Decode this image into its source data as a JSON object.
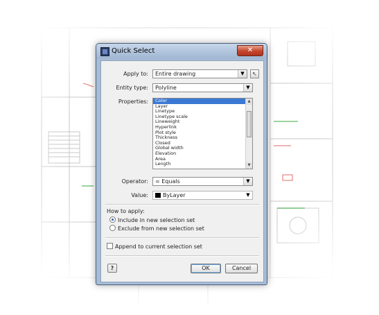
{
  "dialog": {
    "title": "Quick Select",
    "close_glyph": "✕",
    "apply_to": {
      "label": "Apply to:",
      "value": "Entire drawing"
    },
    "pick_icon": "select-objects-icon",
    "entity_type": {
      "label": "Entity type:",
      "value": "Polyline"
    },
    "properties": {
      "label": "Properties:",
      "items": [
        "Color",
        "Layer",
        "Linetype",
        "Linetype scale",
        "Lineweight",
        "Hyperlink",
        "Plot style",
        "Thickness",
        "Closed",
        "Global width",
        "Elevation",
        "Area",
        "Length"
      ],
      "selected_index": 0
    },
    "operator": {
      "label": "Operator:",
      "value": "= Equals"
    },
    "value_field": {
      "label": "Value:",
      "value": "ByLayer",
      "swatch_color": "#000000"
    },
    "how_to_apply": {
      "label": "How to apply:",
      "include": "Include in new selection set",
      "exclude": "Exclude from new selection set",
      "selected": "include"
    },
    "append_label": "Append to current selection set",
    "append_checked": false,
    "help_label": "?",
    "ok_label": "OK",
    "cancel_label": "Cancel"
  },
  "colors": {
    "title_bar": "#a7bcd6",
    "close_button": "#c4452b",
    "selection": "#3a78d4",
    "backdrop_accent_red": "#d9534f",
    "backdrop_accent_green": "#3fae49"
  }
}
